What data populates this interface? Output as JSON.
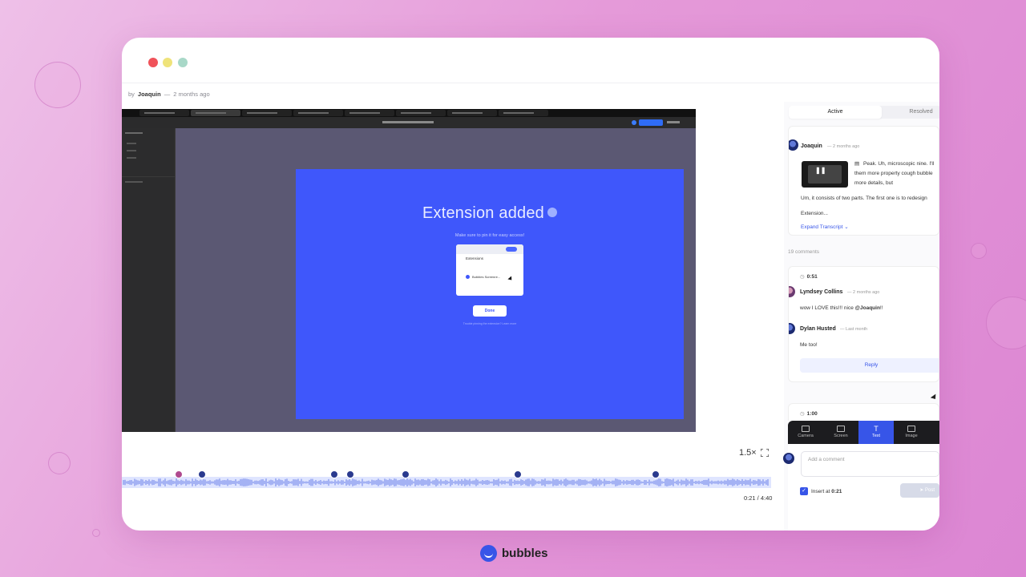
{
  "byline": {
    "prefix": "by",
    "author": "Joaquin",
    "separator": "—",
    "time": "2 months ago"
  },
  "video": {
    "slide_title": "Extension added",
    "slide_subtitle": "Make sure to pin it for easy access!",
    "card_heading": "Extensions",
    "card_item": "Bubbles Screenre...",
    "done_label": "Done",
    "footer_text": "Trouble pinning the extension? Learn more"
  },
  "player": {
    "speed": "1.5×",
    "time": "0:21 / 4:40"
  },
  "panel": {
    "tabs": {
      "active": "Active",
      "resolved": "Resolved"
    },
    "main_comment": {
      "author": "Joaquin",
      "ago": "— 2 months ago",
      "text1": "Peak. Uh, microscopic nine. I'll",
      "text2": "them more property cough bubble",
      "text3": "more details, but",
      "text4": "Um, it consists of two parts. The first one is to redesign",
      "text5": "Extension...",
      "expand": "Expand Transcript"
    },
    "comments_count": "19 comments",
    "thread1": {
      "timestamp": "0:51",
      "c1_author": "Lyndsey Collins",
      "c1_ago": "— 2 months ago",
      "c1_text": "wow I LOVE this!!! nice",
      "c1_mention": "@Joaquin",
      "c1_tail": "!!",
      "c2_author": "Dylan Husted",
      "c2_ago": "— Last month",
      "c2_text": "Me too!",
      "reply": "Reply"
    },
    "thread2": {
      "timestamp": "1:00"
    },
    "composer": {
      "tools": [
        "Camera",
        "Screen",
        "Text",
        "Image"
      ],
      "active_tool": "Text",
      "placeholder": "Add a comment",
      "insert_label": "Insert at",
      "insert_time": "0:21",
      "post": "Post"
    }
  },
  "brand": {
    "name": "bubbles"
  },
  "colors": {
    "accent": "#3755e8",
    "slide_bg": "#3f57fb",
    "page_bg": "#e59ad9"
  }
}
